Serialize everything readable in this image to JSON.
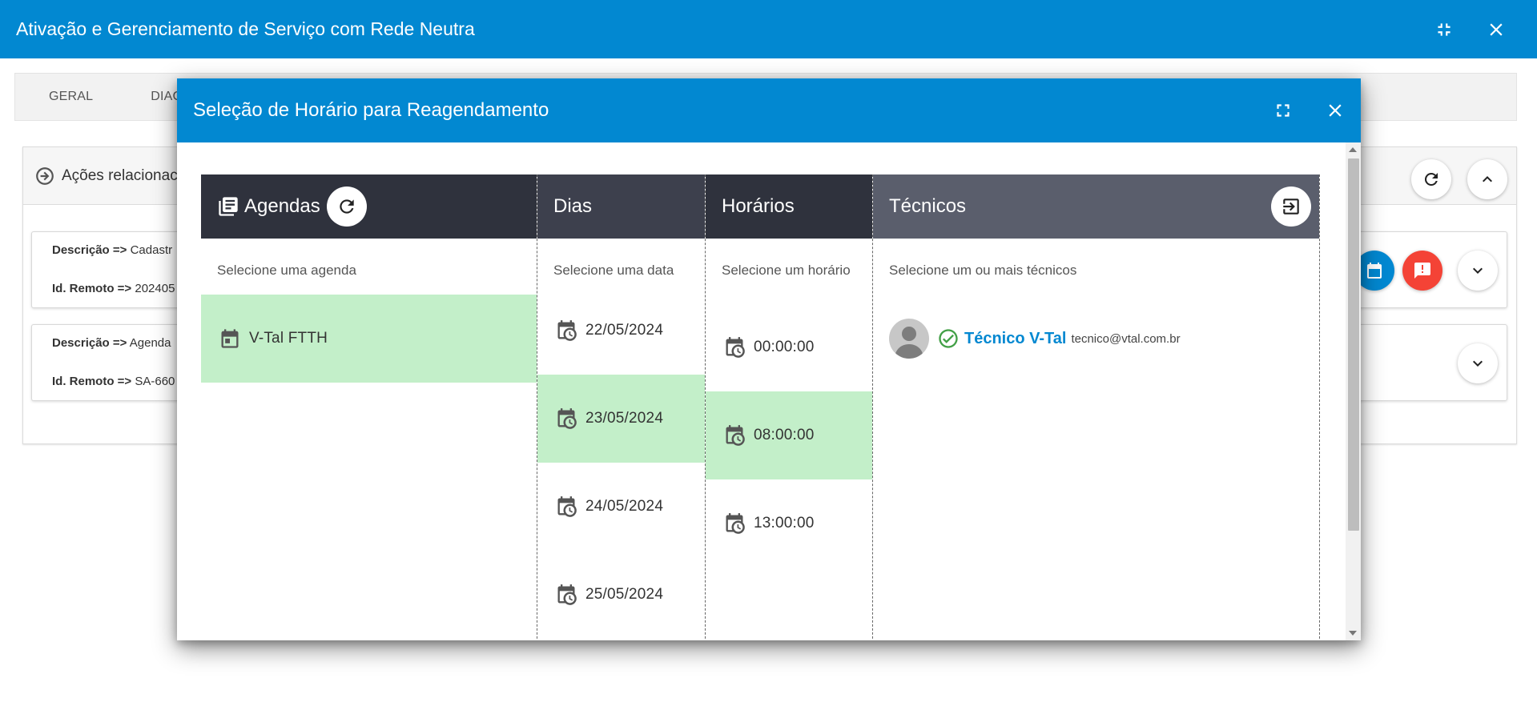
{
  "app": {
    "title": "Ativação e Gerenciamento de Serviço com Rede Neutra"
  },
  "tabs": [
    "GERAL",
    "DIAGN"
  ],
  "actions": {
    "header_label": "Ações relacionac",
    "cards": [
      {
        "line1_label": "Descrição =>",
        "line1_value": "Cadastr",
        "line2_label": "Id. Remoto =>",
        "line2_value": "202405"
      },
      {
        "line1_label": "Descrição =>",
        "line1_value": "Agenda",
        "line2_label": "Id. Remoto =>",
        "line2_value": "SA-660"
      }
    ]
  },
  "modal": {
    "title": "Seleção de Horário para Reagendamento",
    "columns": {
      "agendas": {
        "title": "Agendas",
        "hint": "Selecione uma agenda",
        "items": [
          {
            "label": "V-Tal FTTH",
            "selected": true
          }
        ]
      },
      "dias": {
        "title": "Dias",
        "hint": "Selecione uma data",
        "items": [
          {
            "label": "22/05/2024",
            "selected": false
          },
          {
            "label": "23/05/2024",
            "selected": true
          },
          {
            "label": "24/05/2024",
            "selected": false
          },
          {
            "label": "25/05/2024",
            "selected": false
          }
        ]
      },
      "horarios": {
        "title": "Horários",
        "hint": "Selecione um horário",
        "items": [
          {
            "label": "00:00:00",
            "selected": false
          },
          {
            "label": "08:00:00",
            "selected": true
          },
          {
            "label": "13:00:00",
            "selected": false
          }
        ]
      },
      "tecnicos": {
        "title": "Técnicos",
        "hint": "Selecione um ou mais técnicos",
        "items": [
          {
            "name": "Técnico V-Tal",
            "email": "tecnico@vtal.com.br",
            "selected": true
          }
        ]
      }
    }
  },
  "colors": {
    "brand": "#0288d1",
    "header_agendas": "#2f323d",
    "header_dias": "#3d404d",
    "header_horarios": "#2f323d",
    "header_tecnicos": "#5a5e6c",
    "selected_row": "#c3efc9",
    "check_green": "#43a047",
    "alert_red": "#f44336"
  },
  "icons": {
    "app_header": [
      "minimize-icon",
      "close-icon"
    ],
    "modal_header": [
      "fullscreen-icon",
      "close-icon"
    ],
    "agendas_header": [
      "library-books-icon",
      "refresh-icon"
    ],
    "tecnicos_header": [
      "exit-to-app-icon"
    ],
    "rows": [
      "calendar-icon",
      "calendar-clock-icon"
    ],
    "panel": [
      "arrow-circle-right-icon",
      "refresh-icon",
      "chevron-up-icon",
      "calendar-icon",
      "alert-icon",
      "chevron-down-icon"
    ]
  }
}
